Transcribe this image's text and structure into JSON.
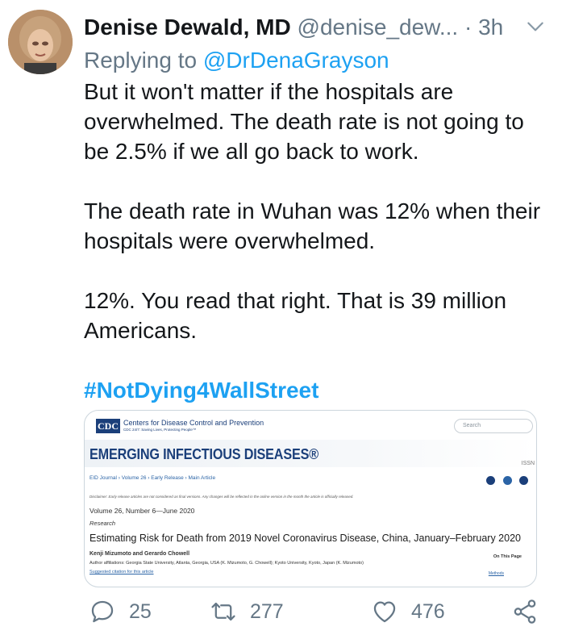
{
  "author": {
    "name": "Denise Dewald, MD",
    "handle": "@denise_dew...",
    "separator": "·",
    "time": "3h"
  },
  "reply_context": {
    "prefix": "Replying to",
    "mention": "@DrDenaGrayson"
  },
  "tweet": {
    "lines": [
      "But it won't matter if the hospitals are",
      "overwhelmed.  The death rate is not going to",
      "be 2.5% if we all go back to work."
    ],
    "lines2": [
      "The death rate in Wuhan was 12% when their",
      "hospitals were overwhelmed."
    ],
    "lines3": [
      "12%.  You read that right. That is 39 million",
      "Americans."
    ],
    "hashtag": "#NotDying4WallStreet"
  },
  "card": {
    "logo": "CDC",
    "org_name": "Centers for Disease Control and Prevention",
    "org_tagline": "CDC 24/7: Saving Lives, Protecting People™",
    "search_placeholder": "Search",
    "journal_title": "EMERGING INFECTIOUS DISEASES®",
    "issn": "ISSN",
    "breadcrumbs": "EID Journal  ›  Volume 26  ›  Early Release  ›  Main Article",
    "disclaimer": "Disclaimer: Early release articles are not considered as final versions. Any changes will be reflected in the online version in the month the article is officially released.",
    "volume": "Volume 26, Number 6—June 2020",
    "section": "Research",
    "article_title": "Estimating Risk for Death from 2019 Novel Coronavirus Disease, China, January–February 2020",
    "authors": "Kenji Mizumoto  and Gerardo Chowell",
    "affiliations": "Author affiliations: Georgia State University, Atlanta, Georgia, USA (K. Mizumoto, G. Chowell); Kyoto University, Kyoto, Japan (K. Mizumoto)",
    "citation": "Suggested citation for this article",
    "on_this_page": "On This Page",
    "methods": "Methods"
  },
  "actions": {
    "replies": "25",
    "retweets": "277",
    "likes": "476"
  },
  "colors": {
    "link": "#1da1f2",
    "muted": "#657786",
    "cdc_blue": "#1b3f7a"
  }
}
